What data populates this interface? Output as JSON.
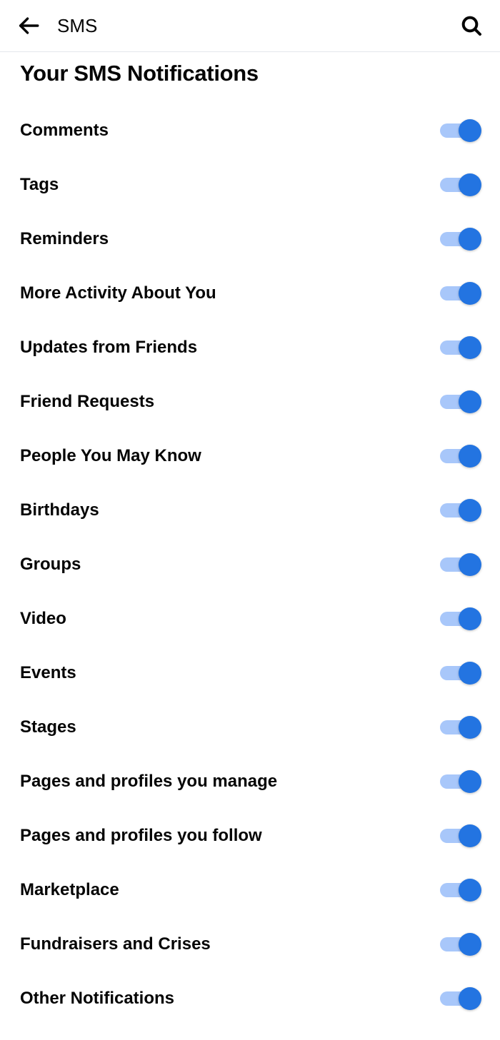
{
  "header": {
    "title": "SMS"
  },
  "page": {
    "title": "Your SMS Notifications"
  },
  "settings": [
    {
      "key": "comments",
      "label": "Comments",
      "on": true
    },
    {
      "key": "tags",
      "label": "Tags",
      "on": true
    },
    {
      "key": "reminders",
      "label": "Reminders",
      "on": true
    },
    {
      "key": "more-activity",
      "label": "More Activity About You",
      "on": true
    },
    {
      "key": "updates-friends",
      "label": "Updates from Friends",
      "on": true
    },
    {
      "key": "friend-requests",
      "label": "Friend Requests",
      "on": true
    },
    {
      "key": "people-you-may-know",
      "label": "People You May Know",
      "on": true
    },
    {
      "key": "birthdays",
      "label": "Birthdays",
      "on": true
    },
    {
      "key": "groups",
      "label": "Groups",
      "on": true
    },
    {
      "key": "video",
      "label": "Video",
      "on": true
    },
    {
      "key": "events",
      "label": "Events",
      "on": true
    },
    {
      "key": "stages",
      "label": "Stages",
      "on": true
    },
    {
      "key": "pages-manage",
      "label": "Pages and profiles you manage",
      "on": true
    },
    {
      "key": "pages-follow",
      "label": "Pages and profiles you follow",
      "on": true
    },
    {
      "key": "marketplace",
      "label": "Marketplace",
      "on": true
    },
    {
      "key": "fundraisers",
      "label": "Fundraisers and Crises",
      "on": true
    },
    {
      "key": "other",
      "label": "Other Notifications",
      "on": true
    }
  ]
}
